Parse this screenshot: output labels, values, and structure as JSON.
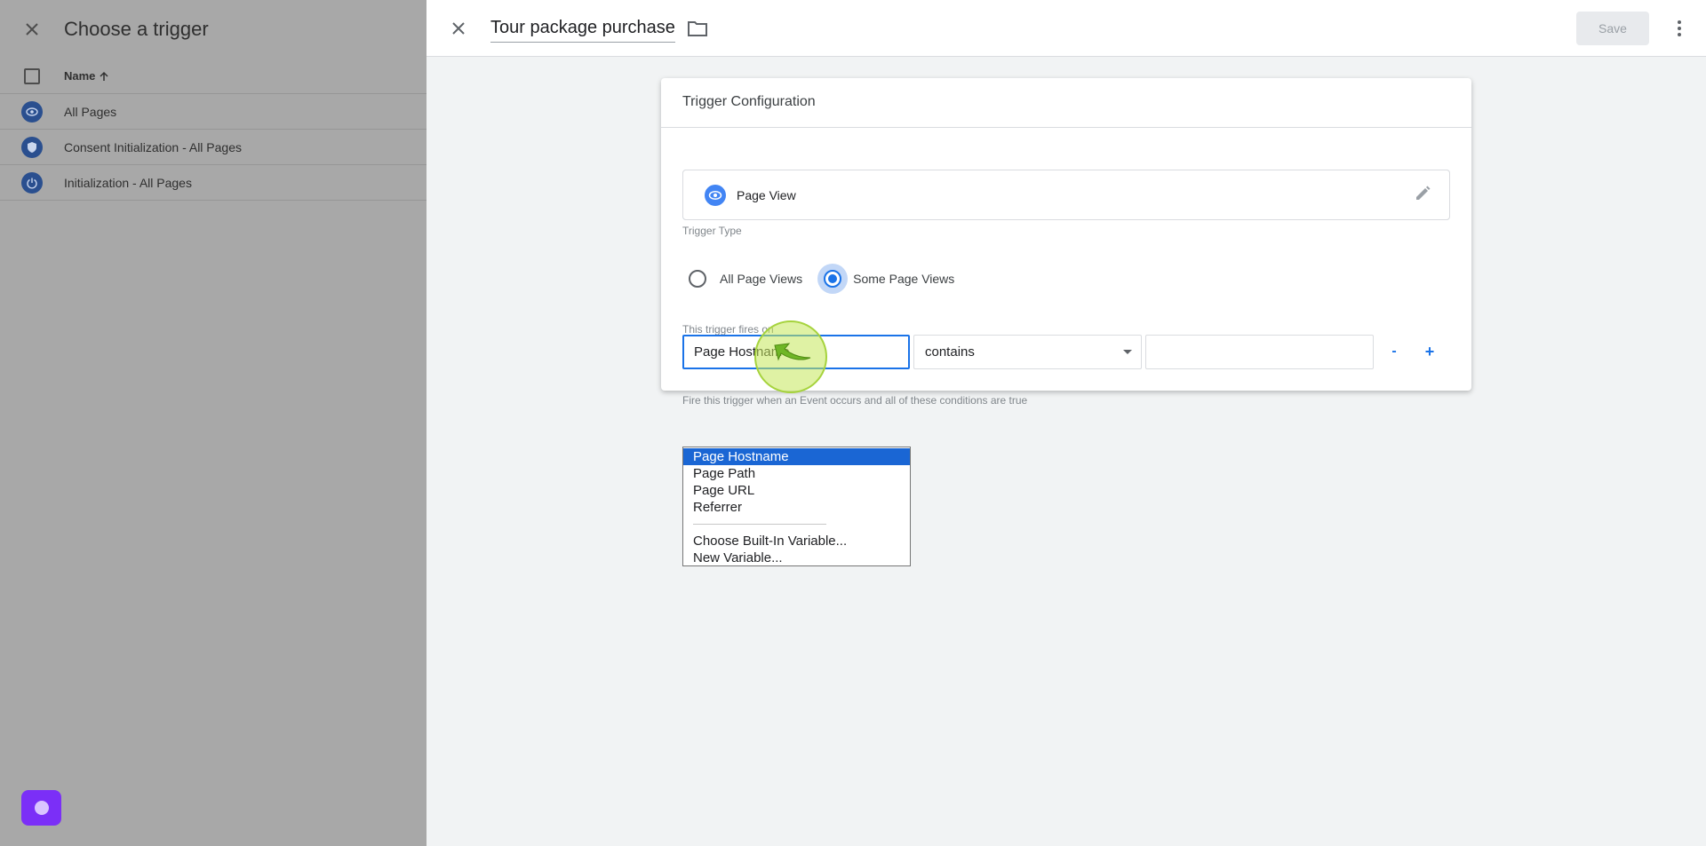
{
  "left_panel": {
    "title": "Choose a trigger",
    "column_name": "Name",
    "triggers": [
      {
        "label": "All Pages",
        "icon": "eye-icon"
      },
      {
        "label": "Consent Initialization - All Pages",
        "icon": "shield-icon"
      },
      {
        "label": "Initialization - All Pages",
        "icon": "power-icon"
      }
    ]
  },
  "editor": {
    "trigger_name": "Tour package purchase",
    "save_label": "Save",
    "card": {
      "title": "Trigger Configuration",
      "trigger_type_label": "Trigger Type",
      "trigger_type_value": "Page View",
      "fires_on_label": "This trigger fires on",
      "radio_all": "All Page Views",
      "radio_some": "Some Page Views",
      "selected_radio": "Some Page Views",
      "condition_label": "Fire this trigger when an Event occurs and all of these conditions are true",
      "condition": {
        "variable": "Page Hostname",
        "operator": "contains",
        "value": ""
      },
      "minus_label": "-",
      "plus_label": "+"
    },
    "dropdown": {
      "options": [
        "Page Hostname",
        "Page Path",
        "Page URL",
        "Referrer"
      ],
      "extra_options": [
        "Choose Built-In Variable...",
        "New Variable..."
      ],
      "selected": "Page Hostname"
    }
  },
  "colors": {
    "accent": "#1a73e8",
    "fab": "#7b2ff7",
    "overlay": "#a8a8a8"
  }
}
